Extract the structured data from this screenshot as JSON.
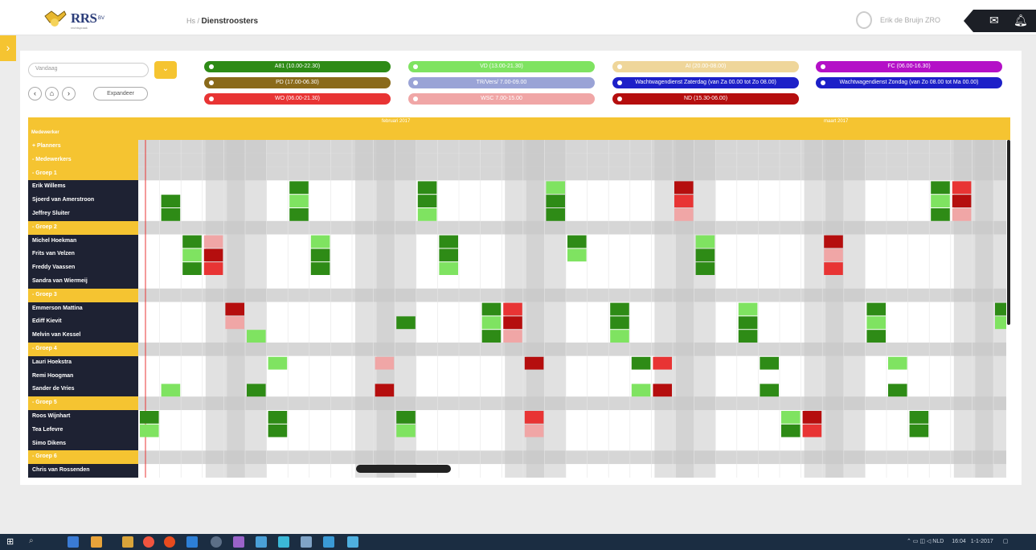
{
  "header": {
    "logo_text": "RRS",
    "logo_sub": "BV",
    "logo_tagline": "rechtspraak",
    "breadcrumb_root": "Hs",
    "breadcrumb_sep": "/",
    "breadcrumb_current": "Dienstroosters",
    "user_name": "Erik de Bruijn ZRO",
    "icons": [
      "user-avatar-icon",
      "mail-icon",
      "bell-icon"
    ]
  },
  "toolbar": {
    "date_value": "Vandaag",
    "expand_label": "Expandeer",
    "nav": [
      "‹",
      "⌂",
      "›"
    ]
  },
  "legend": [
    {
      "label": "A81 (10.00-22.30)",
      "color": "#2e8b16"
    },
    {
      "label": "VD (13.00-21.30)",
      "color": "#7fe361"
    },
    {
      "label": "AI (20.00-08.00)",
      "color": "#efd69a"
    },
    {
      "label": "FC (06.00-16.30)",
      "color": "#b410c7"
    },
    {
      "label": "PD (17.00-06.30)",
      "color": "#8a6a1a"
    },
    {
      "label": "TR/Vers/ 7.00-09.00",
      "color": "#9aa3d6"
    },
    {
      "label": "Wachtwagendienst Zaterdag (van Za 00.00 tot Zo 08.00)",
      "color": "#1d20c8"
    },
    {
      "label": "Wachtwagendienst Zondag (van Zo 08.00 tot Ma 00.00)",
      "color": "#1d20c8"
    },
    {
      "label": "WO (06.00-21.30)",
      "color": "#e83434"
    },
    {
      "label": "WSC 7.00-15.00",
      "color": "#f0a6a6"
    },
    {
      "label": "ND (15.30-06.00)",
      "color": "#b50e0e"
    }
  ],
  "grid": {
    "corner_label": "Medewerker",
    "month1": "februari 2017",
    "month2": "maart 2017",
    "rows": [
      {
        "type": "section",
        "label": "+ Planners"
      },
      {
        "type": "section",
        "label": "- Medewerkers"
      },
      {
        "type": "group",
        "label": "- Groep 1"
      },
      {
        "type": "person",
        "label": "Erik Willems"
      },
      {
        "type": "person",
        "label": "Sjoerd van Amerstroon"
      },
      {
        "type": "person",
        "label": "Jeffrey Sluiter"
      },
      {
        "type": "group",
        "label": "- Groep 2"
      },
      {
        "type": "person",
        "label": "Michel Hoekman"
      },
      {
        "type": "person",
        "label": "Frits van Velzen"
      },
      {
        "type": "person",
        "label": "Freddy Vaassen"
      },
      {
        "type": "person",
        "label": "Sandra van Wiermeij"
      },
      {
        "type": "group",
        "label": "- Groep 3"
      },
      {
        "type": "person",
        "label": "Emmerson Mattina"
      },
      {
        "type": "person",
        "label": "Ediff Kievit"
      },
      {
        "type": "person",
        "label": "Melvin van Kessel"
      },
      {
        "type": "group",
        "label": "- Groep 4"
      },
      {
        "type": "person",
        "label": "Lauri Hoekstra"
      },
      {
        "type": "person",
        "label": "Remi Hoogman"
      },
      {
        "type": "person",
        "label": "Sander de Vries"
      },
      {
        "type": "group",
        "label": "- Groep 5"
      },
      {
        "type": "person",
        "label": "Roos Wijnhart"
      },
      {
        "type": "person",
        "label": "Tea Lefevre"
      },
      {
        "type": "person",
        "label": "Simo Dikens"
      },
      {
        "type": "group",
        "label": "- Groep 6"
      },
      {
        "type": "person",
        "label": "Chris van Rossenden"
      }
    ]
  },
  "taskbar": {
    "lang": "NLD",
    "time": "16:04",
    "date": "1-1-2017"
  }
}
